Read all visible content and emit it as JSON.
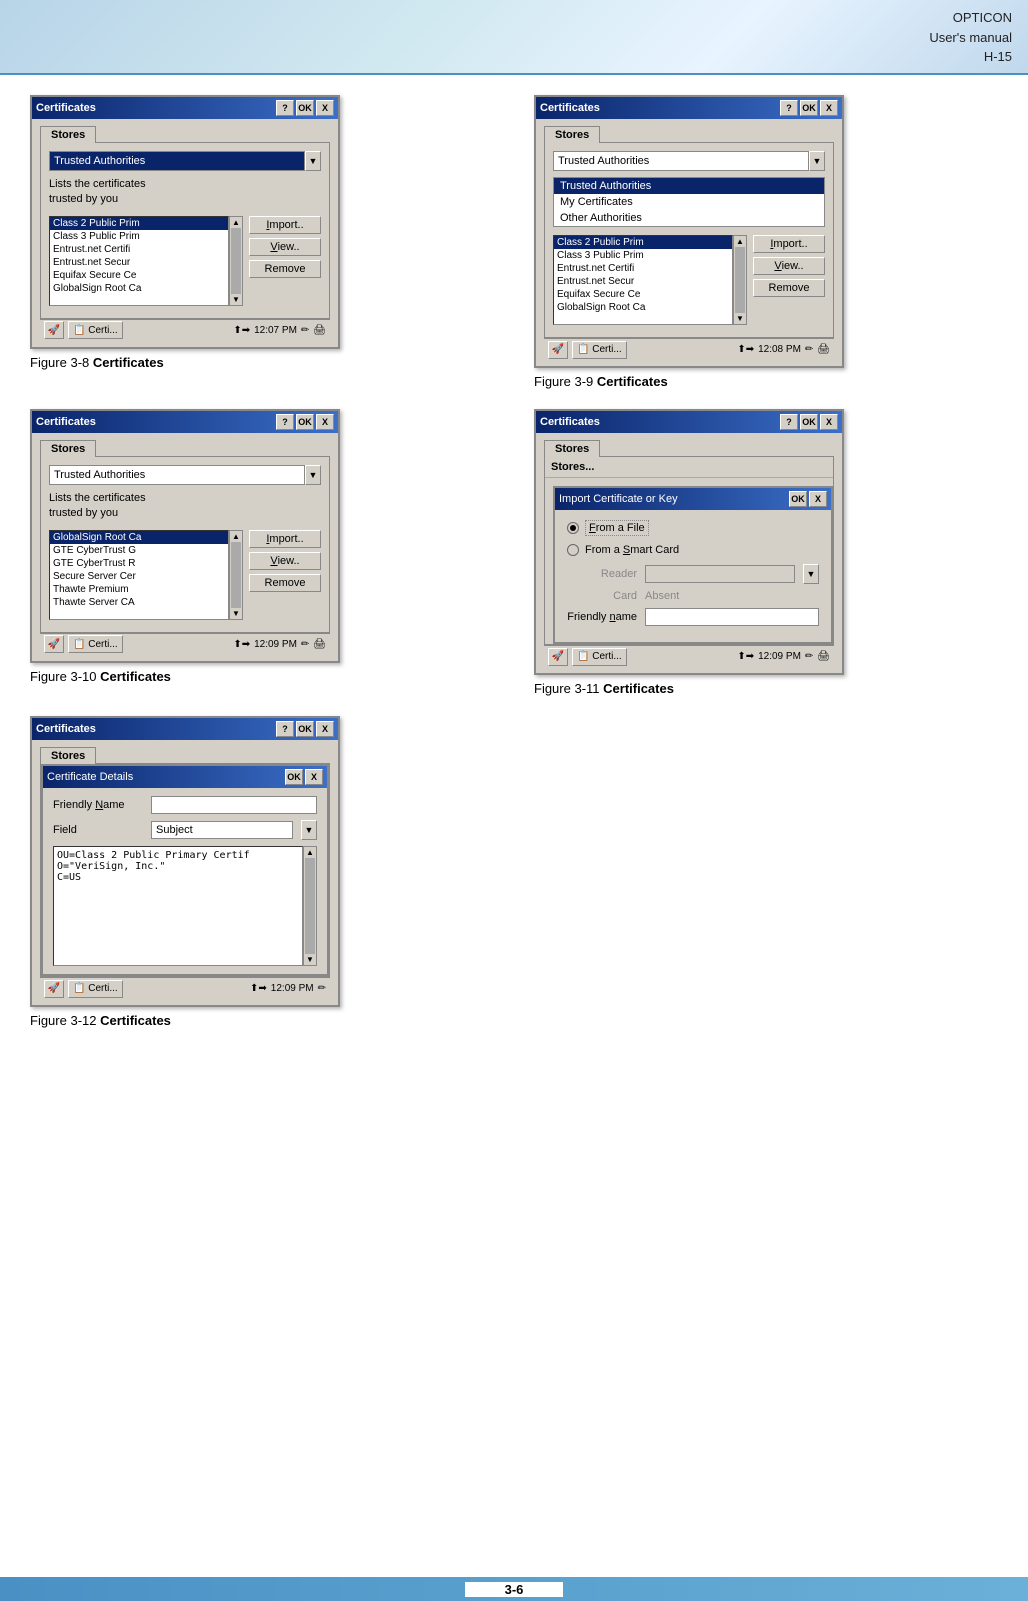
{
  "header": {
    "brand": "OPTICON",
    "line2": "User's manual",
    "line3": "H-15"
  },
  "figures": [
    {
      "id": "fig3-8",
      "caption_num": "Figure 3-8",
      "caption_bold": "Certificates",
      "dialog": {
        "title": "Certificates",
        "tab": "Stores",
        "dropdown_value": "Trusted Authorities",
        "dropdown_highlighted": true,
        "description": "Lists the certificates trusted by you",
        "list_items": [
          {
            "text": "Class 2 Public Prim",
            "selected": true
          },
          {
            "text": "Class 3 Public Prim"
          },
          {
            "text": "Entrust.net Certifi"
          },
          {
            "text": "Entrust.net Secur"
          },
          {
            "text": "Equifax Secure Ce"
          },
          {
            "text": "GlobalSign Root Ca"
          }
        ],
        "buttons": [
          "Import..",
          "View..",
          "Remove"
        ],
        "time": "12:07 PM"
      }
    },
    {
      "id": "fig3-9",
      "caption_num": "Figure 3-9",
      "caption_bold": "Certificates",
      "dialog": {
        "title": "Certificates",
        "tab": "Stores",
        "dropdown_value": "Trusted Authorities",
        "dropdown_highlighted": false,
        "description": "",
        "dropdown_open": true,
        "dropdown_options": [
          {
            "text": "Trusted Authorities",
            "selected": true
          },
          {
            "text": "My Certificates"
          },
          {
            "text": "Other Authorities"
          }
        ],
        "list_items": [
          {
            "text": "Class 2 Public Prim",
            "selected": true
          },
          {
            "text": "Class 3 Public Prim"
          },
          {
            "text": "Entrust.net Certifi"
          },
          {
            "text": "Entrust.net Secur"
          },
          {
            "text": "Equifax Secure Ce"
          },
          {
            "text": "GlobalSign Root Ca"
          }
        ],
        "buttons": [
          "Import..",
          "View..",
          "Remove"
        ],
        "time": "12:08 PM"
      }
    },
    {
      "id": "fig3-10",
      "caption_num": "Figure 3-10",
      "caption_bold": "Certificates",
      "dialog": {
        "title": "Certificates",
        "tab": "Stores",
        "dropdown_value": "Trusted Authorities",
        "dropdown_highlighted": false,
        "description": "Lists the certificates trusted by you",
        "list_items": [
          {
            "text": "GlobalSign Root Ca",
            "selected": true
          },
          {
            "text": "GTE CyberTrust G"
          },
          {
            "text": "GTE CyberTrust R"
          },
          {
            "text": "Secure Server Cer"
          },
          {
            "text": "Thawte Premium "
          },
          {
            "text": "Thawte Server CA"
          }
        ],
        "buttons": [
          "Import..",
          "View..",
          "Remove"
        ],
        "time": "12:09 PM"
      }
    },
    {
      "id": "fig3-11",
      "caption_num": "Figure 3-11",
      "caption_bold": "Certificates",
      "dialog": {
        "title": "Certificates",
        "tab": "Stores",
        "time": "12:09 PM",
        "subdialog": {
          "title": "Import Certificate or Key",
          "options": [
            {
              "text": "From a File",
              "selected": true,
              "underline": "F"
            },
            {
              "text": "From a Smart Card",
              "selected": false,
              "underline": "S"
            }
          ],
          "reader_label": "Reader",
          "reader_value": "",
          "card_label": "Card",
          "card_value": "Absent",
          "friendly_label": "Friendly name",
          "friendly_value": ""
        }
      }
    },
    {
      "id": "fig3-12",
      "caption_num": "Figure 3-12",
      "caption_bold": "Certificates",
      "dialog": {
        "title": "Certificates",
        "tab": "Stores",
        "time": "12:09 PM",
        "certdetails": {
          "title": "Certificate Details",
          "friendly_name_label": "Friendly Name",
          "friendly_name_value": "",
          "field_label": "Field",
          "field_value": "Subject",
          "details_text": "OU=Class 2 Public Primary Certif\nO=\"VeriSign, Inc.\"\nC=US"
        }
      }
    }
  ],
  "footer": {
    "page": "3-6"
  },
  "labels": {
    "ok": "OK",
    "question": "?",
    "close": "X",
    "start_icon": "🚀",
    "certi_label": "Certi...",
    "remove": "Remove",
    "import": "Import..",
    "view": "View..",
    "stores": "Stores",
    "trusted_authorities": "Trusted Authorities",
    "my_certificates": "My Certificates",
    "other_authorities": "Other Authorities",
    "lists_desc": "Lists the certificates\ntrusted by you",
    "from_file": "From a File",
    "from_smart_card": "From a Smart Card",
    "reader": "Reader",
    "card": "Card",
    "absent": "Absent",
    "friendly_name": "Friendly name",
    "friendly_name2": "Friendly Name",
    "field": "Field",
    "subject": "Subject",
    "ou_text": "OU=Class 2 Public Primary Certif\nO=\"VeriSign, Inc.\"\nC=US"
  }
}
